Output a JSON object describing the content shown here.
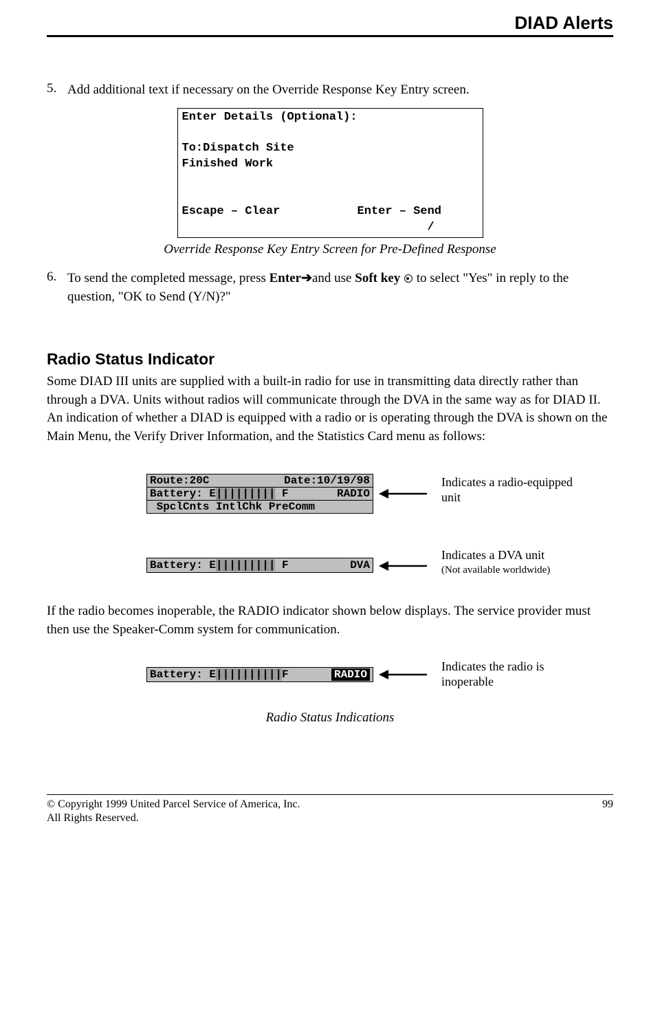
{
  "header": {
    "title": "DIAD Alerts"
  },
  "step5": {
    "num": "5.",
    "text": "Add additional text if necessary on the Override Response Key Entry screen."
  },
  "screen1": {
    "l1": "Enter Details (Optional):",
    "l2": "",
    "l3": "To:Dispatch Site",
    "l4": "Finished Work",
    "l5": "",
    "l6": "",
    "l7_left": "Escape – Clear",
    "l7_right": "Enter – Send",
    "l8": "                                   /"
  },
  "caption1": "Override Response Key Entry Screen for Pre-Defined Response",
  "step6": {
    "num": "6.",
    "pre": "To send the completed message, press ",
    "enter": "Enter",
    "mid": "and use ",
    "softkey": "Soft key",
    "post": " to select \"Yes\" in reply to the question, \"OK to Send (Y/N)?\""
  },
  "section": {
    "heading": "Radio Status Indicator",
    "para1": "Some DIAD III units are supplied with a built-in radio for use in transmitting data directly rather than through a DVA. Units without radios will communicate through the DVA in the same way as for DIAD II. An indication of whether a DIAD is equipped with a radio or is operating through the DVA is shown on the Main Menu, the Verify Driver Information, and the Statistics Card menu as follows:"
  },
  "ind1": {
    "route": "Route:20C",
    "date": "Date:10/19/98",
    "batt_left": "Battery: E",
    "batt_gauge": "|||||||||",
    "batt_f": " F",
    "right": "RADIO",
    "menu": " SpclCnts IntlChk PreComm",
    "annotation": "Indicates a radio-equipped unit"
  },
  "ind2": {
    "batt_left": "Battery: E",
    "batt_gauge": "|||||||||",
    "batt_f": " F",
    "right": "DVA",
    "annotation": "Indicates a DVA unit",
    "annotation_small": "(Not available worldwide)"
  },
  "para2": "If the radio becomes inoperable, the RADIO indicator shown below displays.  The service provider must then use the Speaker-Comm system for communication.",
  "ind3": {
    "batt_left": "Battery: E",
    "batt_gauge": "||||||||||",
    "batt_f": "F",
    "right": "RADIO",
    "annotation": "Indicates the radio is inoperable"
  },
  "caption2": "Radio Status Indications",
  "footer": {
    "copyright": "© Copyright 1999 United Parcel Service of America, Inc.",
    "rights": "All Rights Reserved.",
    "page": "99"
  }
}
